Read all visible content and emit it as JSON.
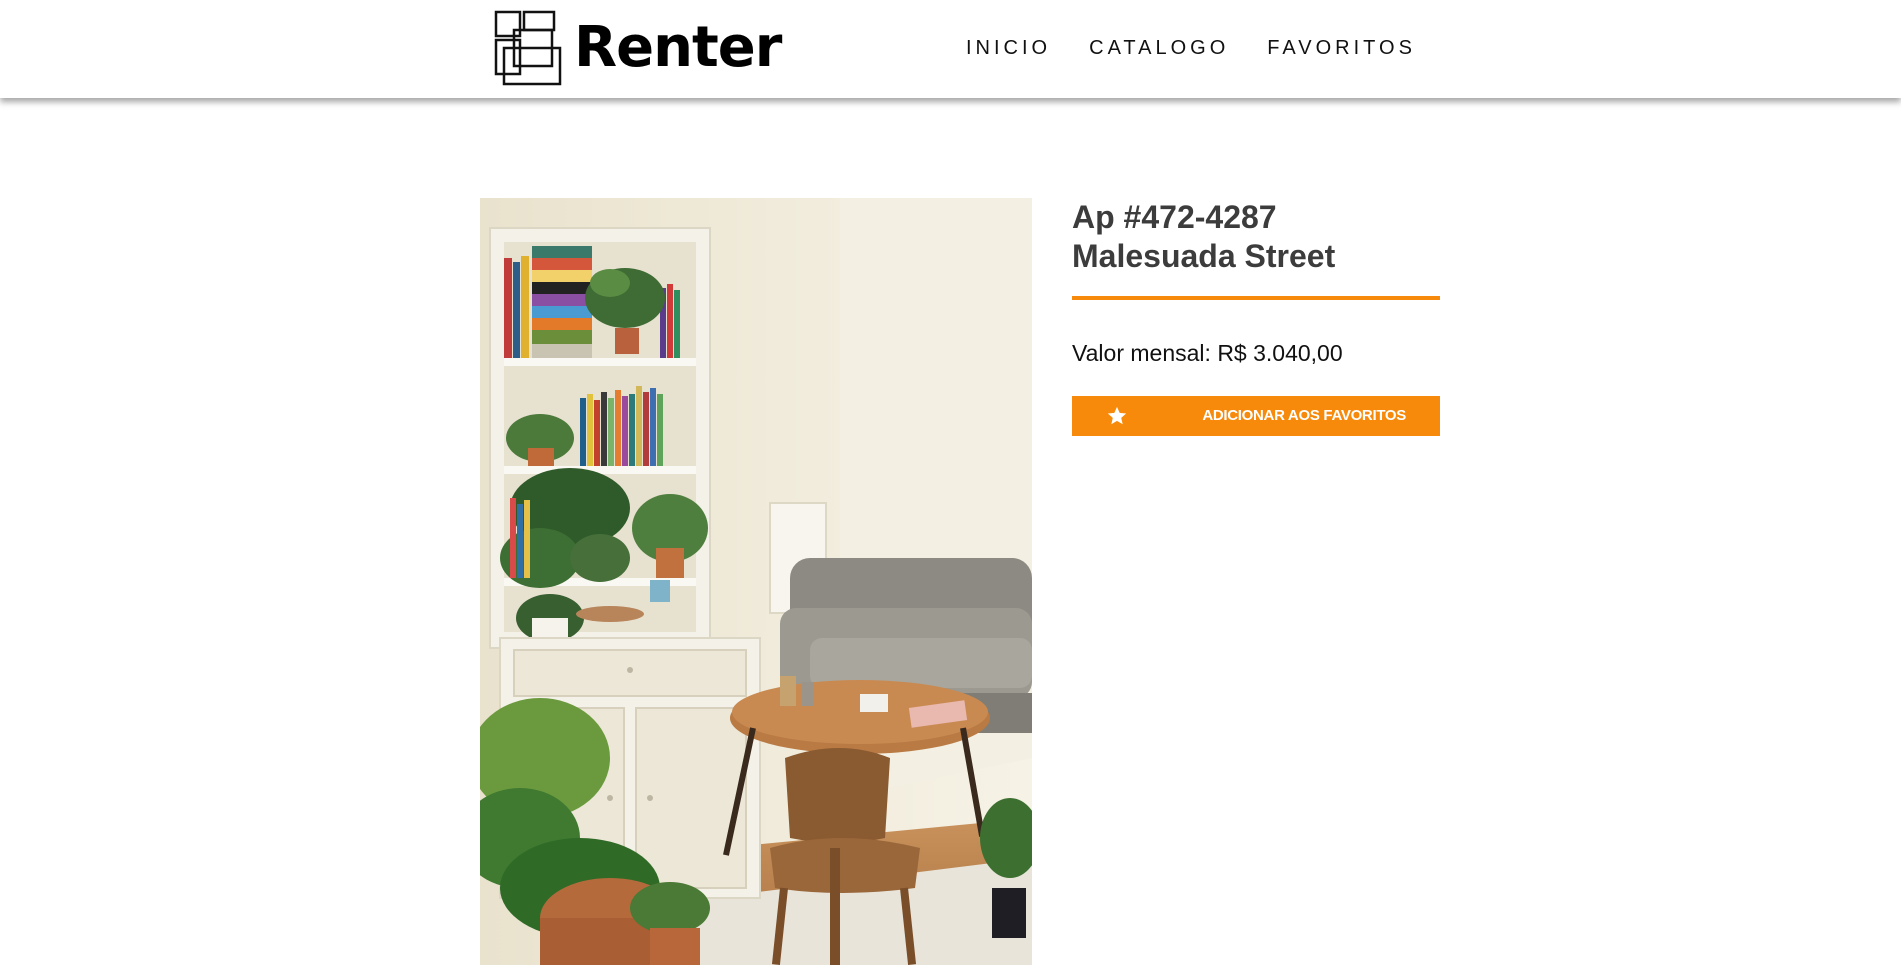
{
  "header": {
    "logo_text": "Renter",
    "nav": [
      {
        "label": "INICIO"
      },
      {
        "label": "CATALOGO"
      },
      {
        "label": "FAVORITOS"
      }
    ]
  },
  "listing": {
    "title_line1": "Ap #472-4287",
    "title_line2": "Malesuada Street",
    "price_label": "Valor mensal:",
    "price_value": "R$ 3.040,00",
    "favorite_button_label": "ADICIONAR AOS FAVORITOS",
    "photo_icon": "apartment-photo"
  },
  "colors": {
    "accent": "#f78a0a",
    "title": "#3c3c3c"
  }
}
